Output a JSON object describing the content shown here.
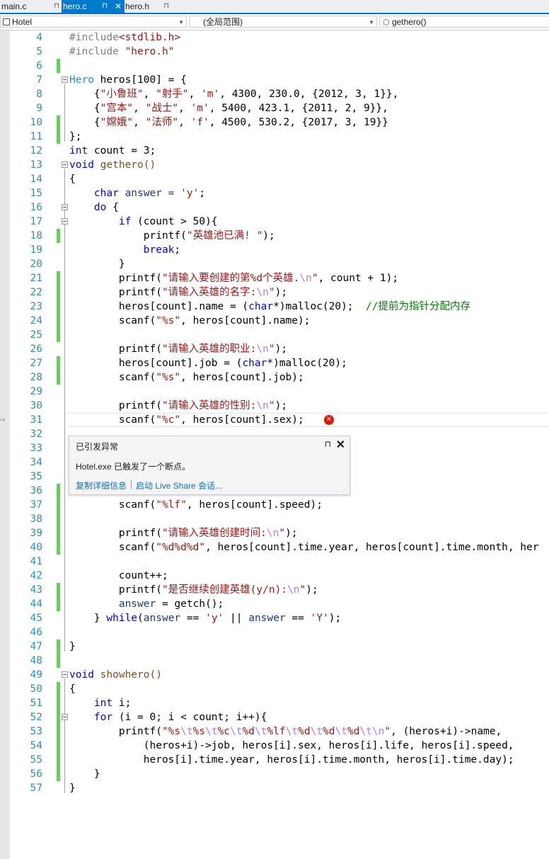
{
  "tabs": [
    {
      "label": "main.c",
      "pin": "⊓"
    },
    {
      "label": "hero.c",
      "pin": "⊓",
      "close": "✕",
      "active": true
    },
    {
      "label": "hero.h",
      "pin": "⊓"
    }
  ],
  "navbar": {
    "project": "Hotel",
    "scope": "(全局范围)",
    "member": "gethero()"
  },
  "line_numbers": [
    "4",
    "5",
    "6",
    "7",
    "8",
    "9",
    "10",
    "11",
    "12",
    "13",
    "14",
    "15",
    "16",
    "17",
    "18",
    "19",
    "20",
    "21",
    "22",
    "23",
    "24",
    "25",
    "26",
    "27",
    "28",
    "29",
    "30",
    "31",
    "32",
    "33",
    "34",
    "35",
    "36",
    "37",
    "38",
    "39",
    "40",
    "41",
    "42",
    "43",
    "44",
    "45",
    "46",
    "47",
    "48",
    "49",
    "50",
    "51",
    "52",
    "53",
    "54",
    "55",
    "56",
    "57"
  ],
  "code": {
    "l4_a": "#include",
    "l4_b": "<stdlib.h>",
    "l5_a": "#include ",
    "l5_b": "\"hero.h\"",
    "l7_a": "Hero",
    "l7_b": " heros[100] = {",
    "l8_a": "    {",
    "l8_b": "\"小鲁班\"",
    "l8_c": ", ",
    "l8_d": "\"射手\"",
    "l8_e": ", ",
    "l8_f": "'m'",
    "l8_g": ", 4300, 230.0, {2012, 3, 1}},",
    "l9_a": "    {",
    "l9_b": "\"宫本\"",
    "l9_c": ", ",
    "l9_d": "\"战士\"",
    "l9_e": ", ",
    "l9_f": "'m'",
    "l9_g": ", 5400, 423.1, {2011, 2, 9}},",
    "l10_a": "    {",
    "l10_b": "\"嫦娥\"",
    "l10_c": ", ",
    "l10_d": "\"法师\"",
    "l10_e": ", ",
    "l10_f": "'f'",
    "l10_g": ", 4500, 530.2, {2017, 3, 19}}",
    "l11": "};",
    "l12_a": "int",
    "l12_b": " count = 3;",
    "l13_a": "void",
    "l13_b": " gethero()",
    "l14": "{",
    "l15_a": "    ",
    "l15_b": "char",
    "l15_c": " answer = ",
    "l15_d": "'y'",
    "l15_e": ";",
    "l16_a": "    ",
    "l16_b": "do",
    "l16_c": " {",
    "l17_a": "        ",
    "l17_b": "if",
    "l17_c": " (count > 50){",
    "l18_a": "            printf(",
    "l18_b": "\"英雄池已满! \"",
    "l18_c": ");",
    "l19_a": "            ",
    "l19_b": "break",
    "l19_c": ";",
    "l20": "        }",
    "l21_a": "        printf(",
    "l21_b": "\"请输入要创建的第%d个英雄.",
    "l21_c": "\\n",
    "l21_d": "\"",
    "l21_e": ", count + 1);",
    "l22_a": "        printf(",
    "l22_b": "\"请输入英雄的名字:",
    "l22_c": "\\n",
    "l22_d": "\"",
    "l22_e": ");",
    "l23_a": "        heros[count].name = (",
    "l23_b": "char",
    "l23_c": "*)malloc(20);  ",
    "l23_d": "//提前为指针分配内存",
    "l24_a": "        scanf(",
    "l24_b": "\"%s\"",
    "l24_c": ", heros[count].name);",
    "l26_a": "        printf(",
    "l26_b": "\"请输入英雄的职业:",
    "l26_c": "\\n",
    "l26_d": "\"",
    "l26_e": ");",
    "l27_a": "        heros[count].job = (",
    "l27_b": "char",
    "l27_c": "*)malloc(20);",
    "l28_a": "        scanf(",
    "l28_b": "\"%s\"",
    "l28_c": ", heros[count].job);",
    "l30_a": "        printf(",
    "l30_b": "\"请输入英雄的性别:",
    "l30_c": "\\n",
    "l30_d": "\"",
    "l30_e": ");",
    "l31_a": "        scanf(",
    "l31_b": "\"%c\"",
    "l31_c": ", heros[count].sex);",
    "l37_a": "        scanf(",
    "l37_b": "\"%lf\"",
    "l37_c": ", heros[count].speed);",
    "l39_a": "        printf(",
    "l39_b": "\"请输入英雄创建时间:",
    "l39_c": "\\n",
    "l39_d": "\"",
    "l39_e": ");",
    "l40_a": "        scanf(",
    "l40_b": "\"%d%d%d\"",
    "l40_c": ", heros[count].time.year, heros[count].time.month, her",
    "l42": "        count++;",
    "l43_a": "        printf(",
    "l43_b": "\"是否继续创建英雄(y/n):",
    "l43_c": "\\n",
    "l43_d": "\"",
    "l43_e": ");",
    "l44_a": "        ",
    "l44_b": "answer",
    "l44_c": " = getch();",
    "l45_a": "    } ",
    "l45_b": "while",
    "l45_c": "(",
    "l45_d": "answer",
    "l45_e": " == ",
    "l45_f": "'y'",
    "l45_g": " || ",
    "l45_h": "answer",
    "l45_i": " == ",
    "l45_j": "'Y'",
    "l45_k": ");",
    "l47": "}",
    "l49_a": "void",
    "l49_b": " showhero()",
    "l50": "{",
    "l51_a": "    ",
    "l51_b": "int",
    "l51_c": " i;",
    "l52_a": "    ",
    "l52_b": "for",
    "l52_c": " (i = 0; i < count; i++){",
    "l53_a": "        printf(",
    "l53_b": "\"%s",
    "l53_c": "\\t",
    "l53_d": "%s",
    "l53_e": "\\t",
    "l53_f": "%c",
    "l53_g": "\\t",
    "l53_h": "%d",
    "l53_i": "\\t",
    "l53_j": "%lf",
    "l53_k": "\\t",
    "l53_l": "%d",
    "l53_m": "\\t",
    "l53_n": "%d",
    "l53_o": "\\t",
    "l53_p": "%d",
    "l53_q": "\\t\\n",
    "l53_r": "\"",
    "l53_s": ", (heros+i)->name,",
    "l54": "            (heros+i)->job, heros[i].sex, heros[i].life, heros[i].speed,",
    "l55": "            heros[i].time.year, heros[i].time.month, heros[i].time.day);",
    "l56": "    }",
    "l57": "}"
  },
  "exception_popup": {
    "title": "已引发异常",
    "message": "Hotel.exe 已触发了一个断点。",
    "link_copy": "复制详细信息",
    "link_liveshare": "启动 Live Share 会话...",
    "pin": "⊓",
    "close": "✕"
  },
  "colors": {
    "accent": "#007acc",
    "error": "#e51400",
    "changed": "#6ccb5f"
  }
}
